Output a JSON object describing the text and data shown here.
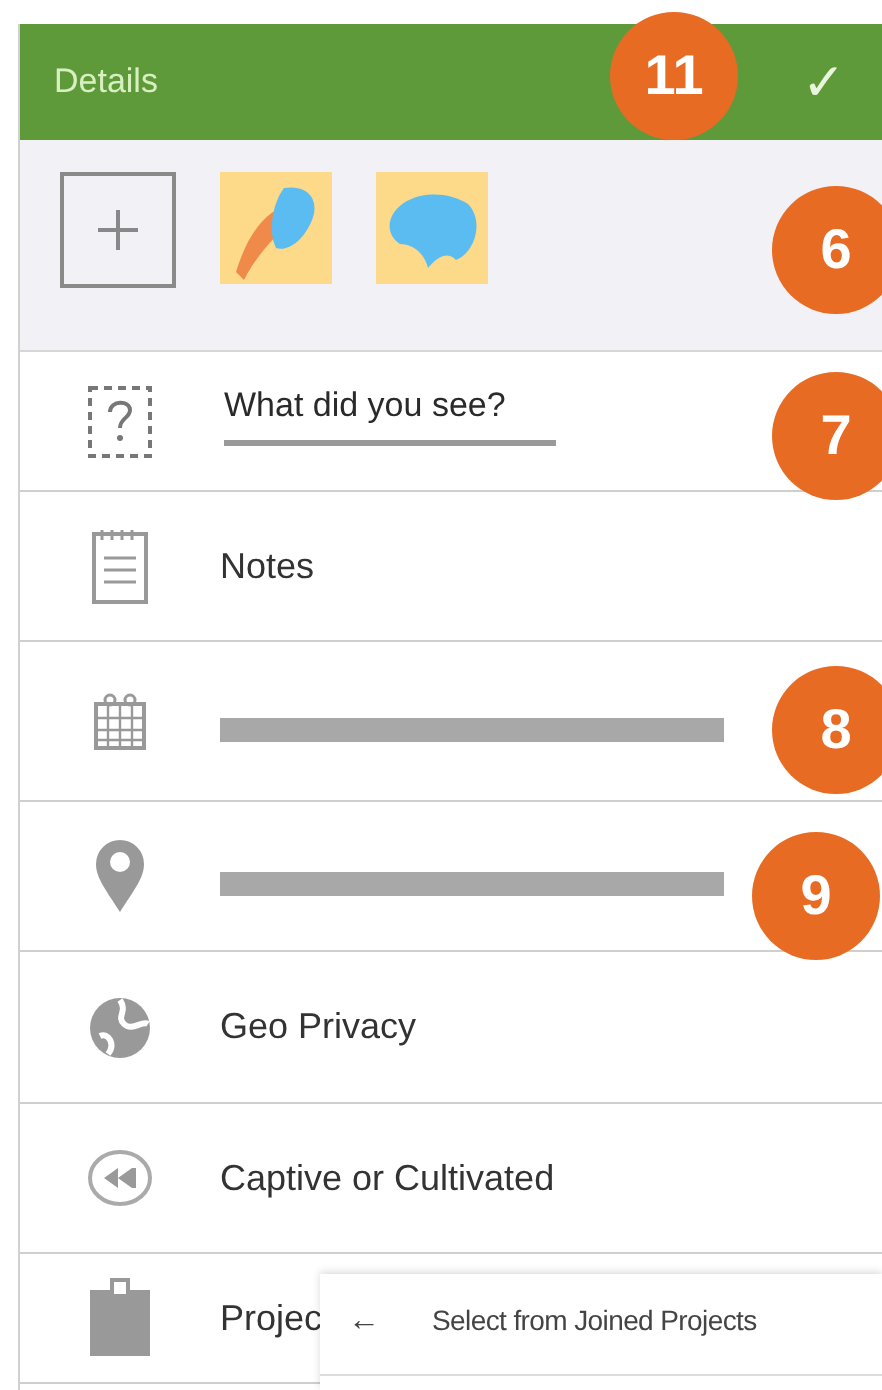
{
  "header": {
    "title": "Details",
    "confirm": "✓"
  },
  "photos": [
    {
      "kind": "add"
    },
    {
      "kind": "picture"
    },
    {
      "kind": "picture"
    }
  ],
  "rows": [
    {
      "kind": "input",
      "placeholder": "What did you see?"
    },
    {
      "kind": "text",
      "label": "Notes"
    },
    {
      "kind": "bar"
    },
    {
      "kind": "bar"
    },
    {
      "kind": "text",
      "label": "Geo Privacy"
    },
    {
      "kind": "text",
      "label": "Captive or Cultivated"
    },
    {
      "kind": "text",
      "label": "Projec"
    }
  ],
  "popup": {
    "back": "←",
    "title": "Select from Joined Projects"
  },
  "callouts": [
    {
      "label": "11"
    },
    {
      "label": "6"
    },
    {
      "label": "7"
    },
    {
      "label": "8"
    },
    {
      "label": "9"
    }
  ]
}
